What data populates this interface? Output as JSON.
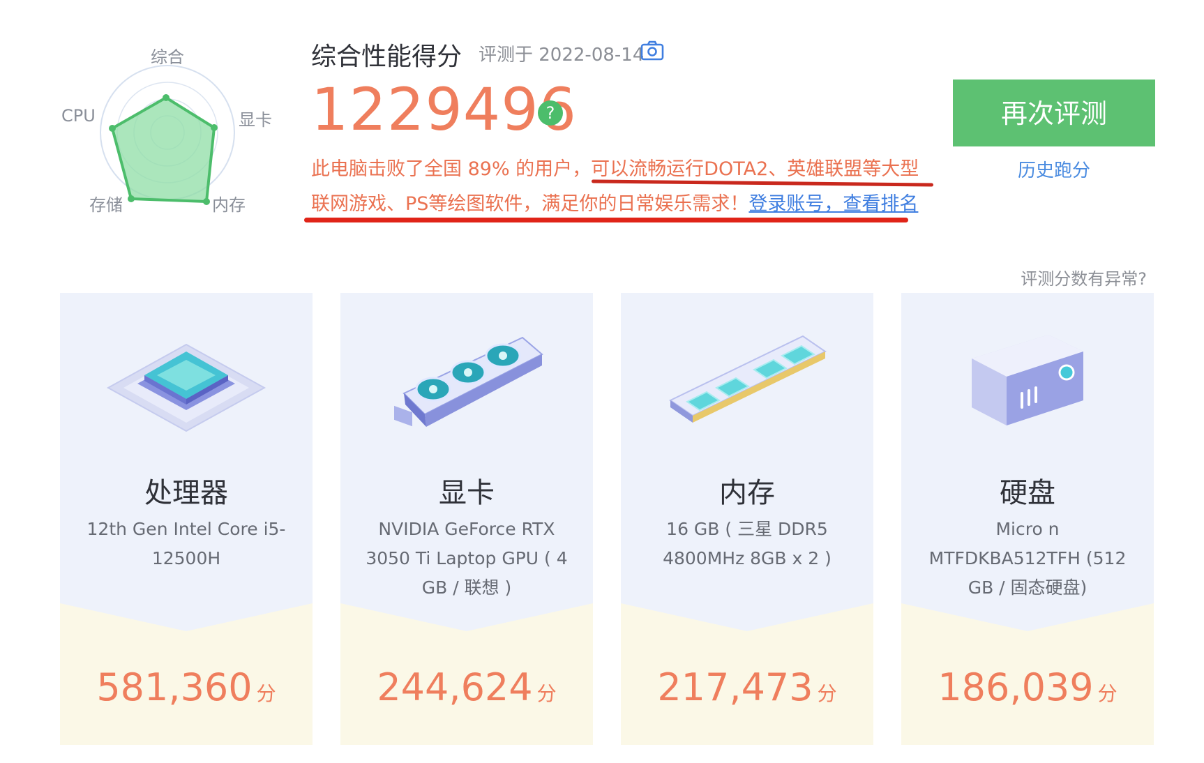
{
  "radar": {
    "labels": {
      "overall": "综合",
      "gpu": "显卡",
      "memory": "内存",
      "storage": "存储",
      "cpu": "CPU"
    }
  },
  "header": {
    "title": "综合性能得分",
    "date": "评测于 2022-08-14",
    "score": "1229496",
    "help_glyph": "?"
  },
  "description": {
    "text": "此电脑击败了全国 89% 的用户，可以流畅运行DOTA2、英雄联盟等大型联网游戏、PS等绘图软件，满足你的日常娱乐需求！",
    "login_link": "登录账号，查看排名"
  },
  "actions": {
    "retest": "再次评测",
    "history": "历史跑分",
    "anomaly": "评测分数有异常?"
  },
  "cards": [
    {
      "title": "处理器",
      "desc": "12th Gen Intel Core i5-12500H",
      "score": "581,360",
      "unit": "分",
      "icon": "cpu-chip-icon"
    },
    {
      "title": "显卡",
      "desc": "NVIDIA GeForce RTX 3050 Ti Laptop GPU ( 4 GB / 联想 )",
      "score": "244,624",
      "unit": "分",
      "icon": "graphics-card-icon"
    },
    {
      "title": "内存",
      "desc": "16 GB ( 三星 DDR5 4800MHz 8GB x 2 )",
      "score": "217,473",
      "unit": "分",
      "icon": "memory-stick-icon"
    },
    {
      "title": "硬盘",
      "desc": "Micro n MTFDKBA512TFH (512 GB / 固态硬盘)",
      "score": "186,039",
      "unit": "分",
      "icon": "hard-drive-icon"
    }
  ],
  "colors": {
    "accent_orange": "#ef7e5d",
    "accent_green": "#5dc172",
    "link_blue": "#3f7ee0"
  }
}
